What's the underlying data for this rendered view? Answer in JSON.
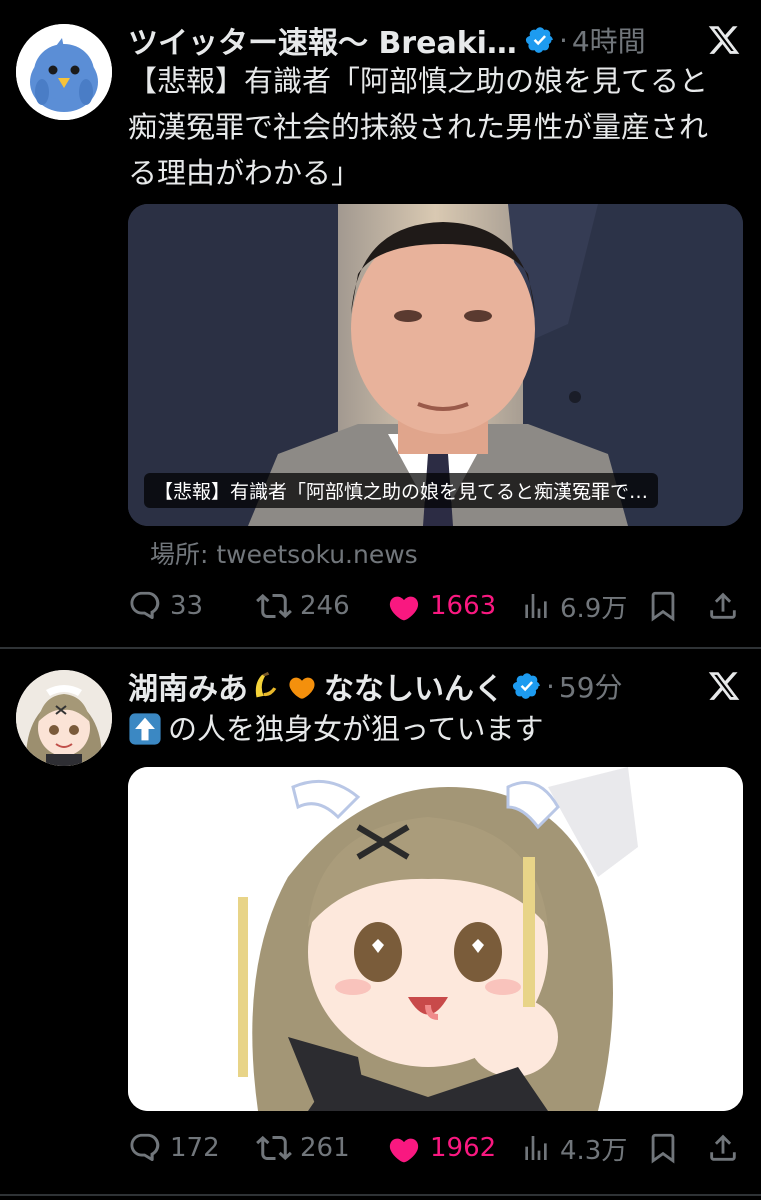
{
  "tweets": [
    {
      "author_name": "ツイッター速報〜 Breaki…",
      "time": "4時間",
      "separator": "·",
      "text_lines": [
        "【悲報】有識者「阿部慎之助の娘を見てると",
        "痴漢冤罪で社会的抹殺された男性が量産され",
        "る理由がわかる」"
      ],
      "card_caption": "【悲報】有識者「阿部慎之助の娘を見てると痴漢冤罪で…",
      "source": "場所: tweetsoku.news",
      "replies": "33",
      "retweets": "246",
      "likes": "1663",
      "views": "6.9万",
      "verified": true,
      "avatar_icon": "blue-bird-icon"
    },
    {
      "author_name_prefix": "湖南みあ",
      "author_name_suffix": "ななしいんく",
      "author_emojis": [
        "banana-emoji-icon",
        "orange-heart-icon"
      ],
      "time": "59分",
      "separator": "·",
      "text": "の人を独身女が狙っています",
      "text_emoji": "up-arrow-emoji-icon",
      "replies": "172",
      "retweets": "261",
      "likes": "1962",
      "views": "4.3万",
      "verified": true
    }
  ],
  "colors": {
    "background": "#000000",
    "text": "#e7e9ea",
    "muted": "#71767b",
    "like": "#f91880",
    "verified": "#1d9bf0",
    "divider": "#2f3336"
  }
}
